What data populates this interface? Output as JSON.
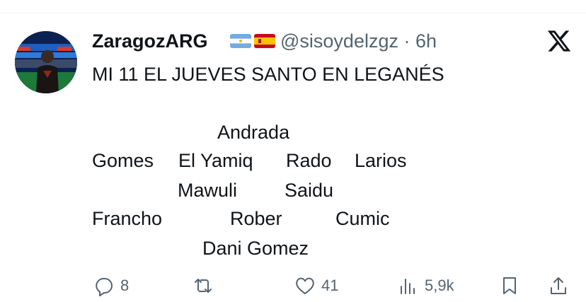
{
  "tweet": {
    "display_name": "ZaragozARG",
    "flags": [
      "argentina-flag",
      "spain-flag"
    ],
    "handle": "@sisoydelzgz",
    "separator": "·",
    "time": "6h",
    "title_line": "MI 11 EL JUEVES SANTO EN LEGANÉS",
    "lineup": {
      "goalkeeper": "Andrada",
      "defenders": [
        "Gomes",
        "El Yamiq",
        "Rado",
        "Larios"
      ],
      "midfielders": [
        "Mawuli",
        "Saidu"
      ],
      "attacking_mid": [
        "Francho",
        "Rober",
        "Cumic"
      ],
      "forward": "Dani Gomez"
    }
  },
  "actions": {
    "replies": "8",
    "likes": "41",
    "views": "5,9k"
  },
  "icons": {
    "logo": "x-logo-icon",
    "reply": "reply-icon",
    "retweet": "retweet-icon",
    "like": "heart-icon",
    "views": "views-icon",
    "bookmark": "bookmark-icon",
    "share": "share-icon"
  },
  "colors": {
    "text": "#0f1419",
    "muted": "#536471"
  }
}
